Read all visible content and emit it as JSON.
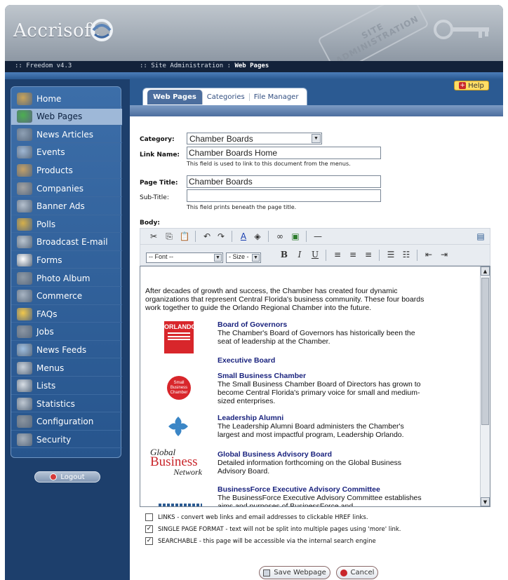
{
  "brand": {
    "name": "Accrisoft",
    "stamp": "SITE ADMINISTRATION"
  },
  "header": {
    "version": ":: Freedom v4.3",
    "breadcrumb_prefix": ":: Site Administration : ",
    "breadcrumb_current": "Web Pages"
  },
  "help": {
    "label": "Help"
  },
  "nav": {
    "items": [
      {
        "label": "Home",
        "icon": "house-icon",
        "active": false
      },
      {
        "label": "Web Pages",
        "icon": "globe-icon",
        "active": true
      },
      {
        "label": "News Articles",
        "icon": "newspaper-icon",
        "active": false
      },
      {
        "label": "Events",
        "icon": "people-icon",
        "active": false
      },
      {
        "label": "Products",
        "icon": "bottle-icon",
        "active": false
      },
      {
        "label": "Companies",
        "icon": "building-icon",
        "active": false
      },
      {
        "label": "Banner Ads",
        "icon": "banner-icon",
        "active": false
      },
      {
        "label": "Polls",
        "icon": "poll-icon",
        "active": false
      },
      {
        "label": "Broadcast E-mail",
        "icon": "broadcast-icon",
        "active": false
      },
      {
        "label": "Forms",
        "icon": "abc-form-icon",
        "active": false
      },
      {
        "label": "Photo Album",
        "icon": "camera-icon",
        "active": false
      },
      {
        "label": "Commerce",
        "icon": "commerce-icon",
        "active": false
      },
      {
        "label": "FAQs",
        "icon": "question-icon",
        "active": false
      },
      {
        "label": "Jobs",
        "icon": "briefcase-icon",
        "active": false
      },
      {
        "label": "News Feeds",
        "icon": "satellite-icon",
        "active": false
      },
      {
        "label": "Menus",
        "icon": "menu-icon",
        "active": false
      },
      {
        "label": "Lists",
        "icon": "list-icon",
        "active": false
      },
      {
        "label": "Statistics",
        "icon": "chart-icon",
        "active": false
      },
      {
        "label": "Configuration",
        "icon": "gear-icon",
        "active": false
      },
      {
        "label": "Security",
        "icon": "lock-icon",
        "active": false
      }
    ],
    "logout": "Logout"
  },
  "tabs": [
    {
      "label": "Web Pages",
      "selected": true
    },
    {
      "label": "Categories",
      "selected": false
    },
    {
      "label": "File Manager",
      "selected": false
    }
  ],
  "form": {
    "category_label": "Category:",
    "category_value": "Chamber Boards",
    "link_name_label": "Link Name:",
    "link_name_value": "Chamber Boards Home",
    "link_name_hint": "This field is used to link to this document from the menus.",
    "page_title_label": "Page Title:",
    "page_title_value": "Chamber Boards",
    "subtitle_label": "Sub-Title:",
    "subtitle_value": "",
    "subtitle_hint": "This field prints beneath the page title.",
    "body_label": "Body:"
  },
  "toolbar": {
    "font_select": "-- Font --",
    "size_select": "- Size -",
    "bold": "B",
    "italic": "I",
    "underline": "U"
  },
  "editor": {
    "intro": "After decades of growth and success, the Chamber has created four dynamic organizations that represent Central Florida's business community. These four boards work together to guide the Orlando Regional Chamber into the future.",
    "boards": [
      {
        "title": "Board of Governors",
        "desc": "The Chamber's Board of Governors has historically been the seat of leadership at the Chamber."
      },
      {
        "title": "Executive Board",
        "desc": ""
      },
      {
        "title": "Small Business Chamber",
        "desc": "The Small Business Chamber Board of Directors has grown to become Central Florida's primary voice for small and medium-sized enterprises."
      },
      {
        "title": "Leadership Alumni",
        "desc": "The Leadership Alumni Board administers the Chamber's largest and most impactful program, Leadership Orlando."
      },
      {
        "title": "Global Business Advisory Board",
        "desc": "Detailed information forthcoming on the Global Business Advisory Board."
      },
      {
        "title": "BusinessForce Executive Advisory Committee",
        "desc": "The BusinessForce Executive Advisory Committee establishes aims and purposes of BusinessForce and"
      }
    ],
    "logos": {
      "orlando": "ORLANDO",
      "small_business": "Small Business Chamber",
      "global_1": "Global",
      "global_2": "Business",
      "global_3": "Network"
    }
  },
  "options": [
    {
      "checked": false,
      "label": "LINKS - convert web links and email addresses to clickable HREF links."
    },
    {
      "checked": true,
      "label": "SINGLE PAGE FORMAT - text will not be split into multiple pages using 'more' link."
    },
    {
      "checked": true,
      "label": "SEARCHABLE - this page will be accessible via the internal search engine"
    }
  ],
  "buttons": {
    "save": "Save Webpage",
    "cancel": "Cancel"
  }
}
